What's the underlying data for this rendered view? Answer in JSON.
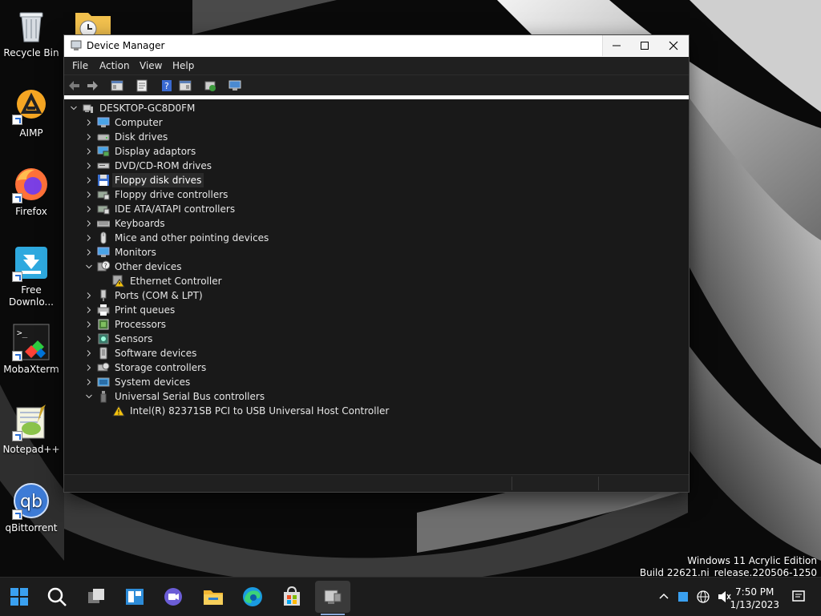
{
  "desktop": {
    "icons": [
      {
        "label": "Recycle Bin",
        "icon": "recycle-bin-icon"
      },
      {
        "label": "AIMP",
        "icon": "aimp-icon"
      },
      {
        "label": "Firefox",
        "icon": "firefox-icon"
      },
      {
        "label": "Free Downlo...",
        "icon": "free-download-manager-icon"
      },
      {
        "label": "MobaXterm",
        "icon": "mobaxterm-icon"
      },
      {
        "label": "Notepad++",
        "icon": "notepadpp-icon"
      },
      {
        "label": "qBittorrent",
        "icon": "qbittorrent-icon"
      }
    ],
    "watermark": {
      "line1": "Windows 11 Acrylic Edition",
      "line2": "Build 22621.ni_release.220506-1250"
    }
  },
  "window": {
    "title": "Device Manager",
    "menu": [
      "File",
      "Action",
      "View",
      "Help"
    ],
    "tree": {
      "root": "DESKTOP-GC8D0FM",
      "categories": [
        {
          "label": "Computer",
          "expanded": false
        },
        {
          "label": "Disk drives",
          "expanded": false
        },
        {
          "label": "Display adaptors",
          "expanded": false
        },
        {
          "label": "DVD/CD-ROM drives",
          "expanded": false
        },
        {
          "label": "Floppy disk drives",
          "expanded": false,
          "selected": true
        },
        {
          "label": "Floppy drive controllers",
          "expanded": false
        },
        {
          "label": "IDE ATA/ATAPI controllers",
          "expanded": false
        },
        {
          "label": "Keyboards",
          "expanded": false
        },
        {
          "label": "Mice and other pointing devices",
          "expanded": false
        },
        {
          "label": "Monitors",
          "expanded": false
        },
        {
          "label": "Other devices",
          "expanded": true,
          "children": [
            "Ethernet Controller"
          ]
        },
        {
          "label": "Ports (COM & LPT)",
          "expanded": false
        },
        {
          "label": "Print queues",
          "expanded": false
        },
        {
          "label": "Processors",
          "expanded": false
        },
        {
          "label": "Sensors",
          "expanded": false
        },
        {
          "label": "Software devices",
          "expanded": false
        },
        {
          "label": "Storage controllers",
          "expanded": false
        },
        {
          "label": "System devices",
          "expanded": false
        },
        {
          "label": "Universal Serial Bus controllers",
          "expanded": true,
          "children": [
            "Intel(R) 82371SB PCI to USB Universal Host Controller"
          ]
        }
      ]
    }
  },
  "taskbar": {
    "clock": {
      "time": "7:50 PM",
      "date": "1/13/2023"
    },
    "apps": [
      "start-icon",
      "search-icon",
      "task-view-icon",
      "widgets-icon",
      "chat-icon",
      "file-explorer-icon",
      "edge-icon",
      "store-icon",
      "device-manager-icon"
    ]
  }
}
